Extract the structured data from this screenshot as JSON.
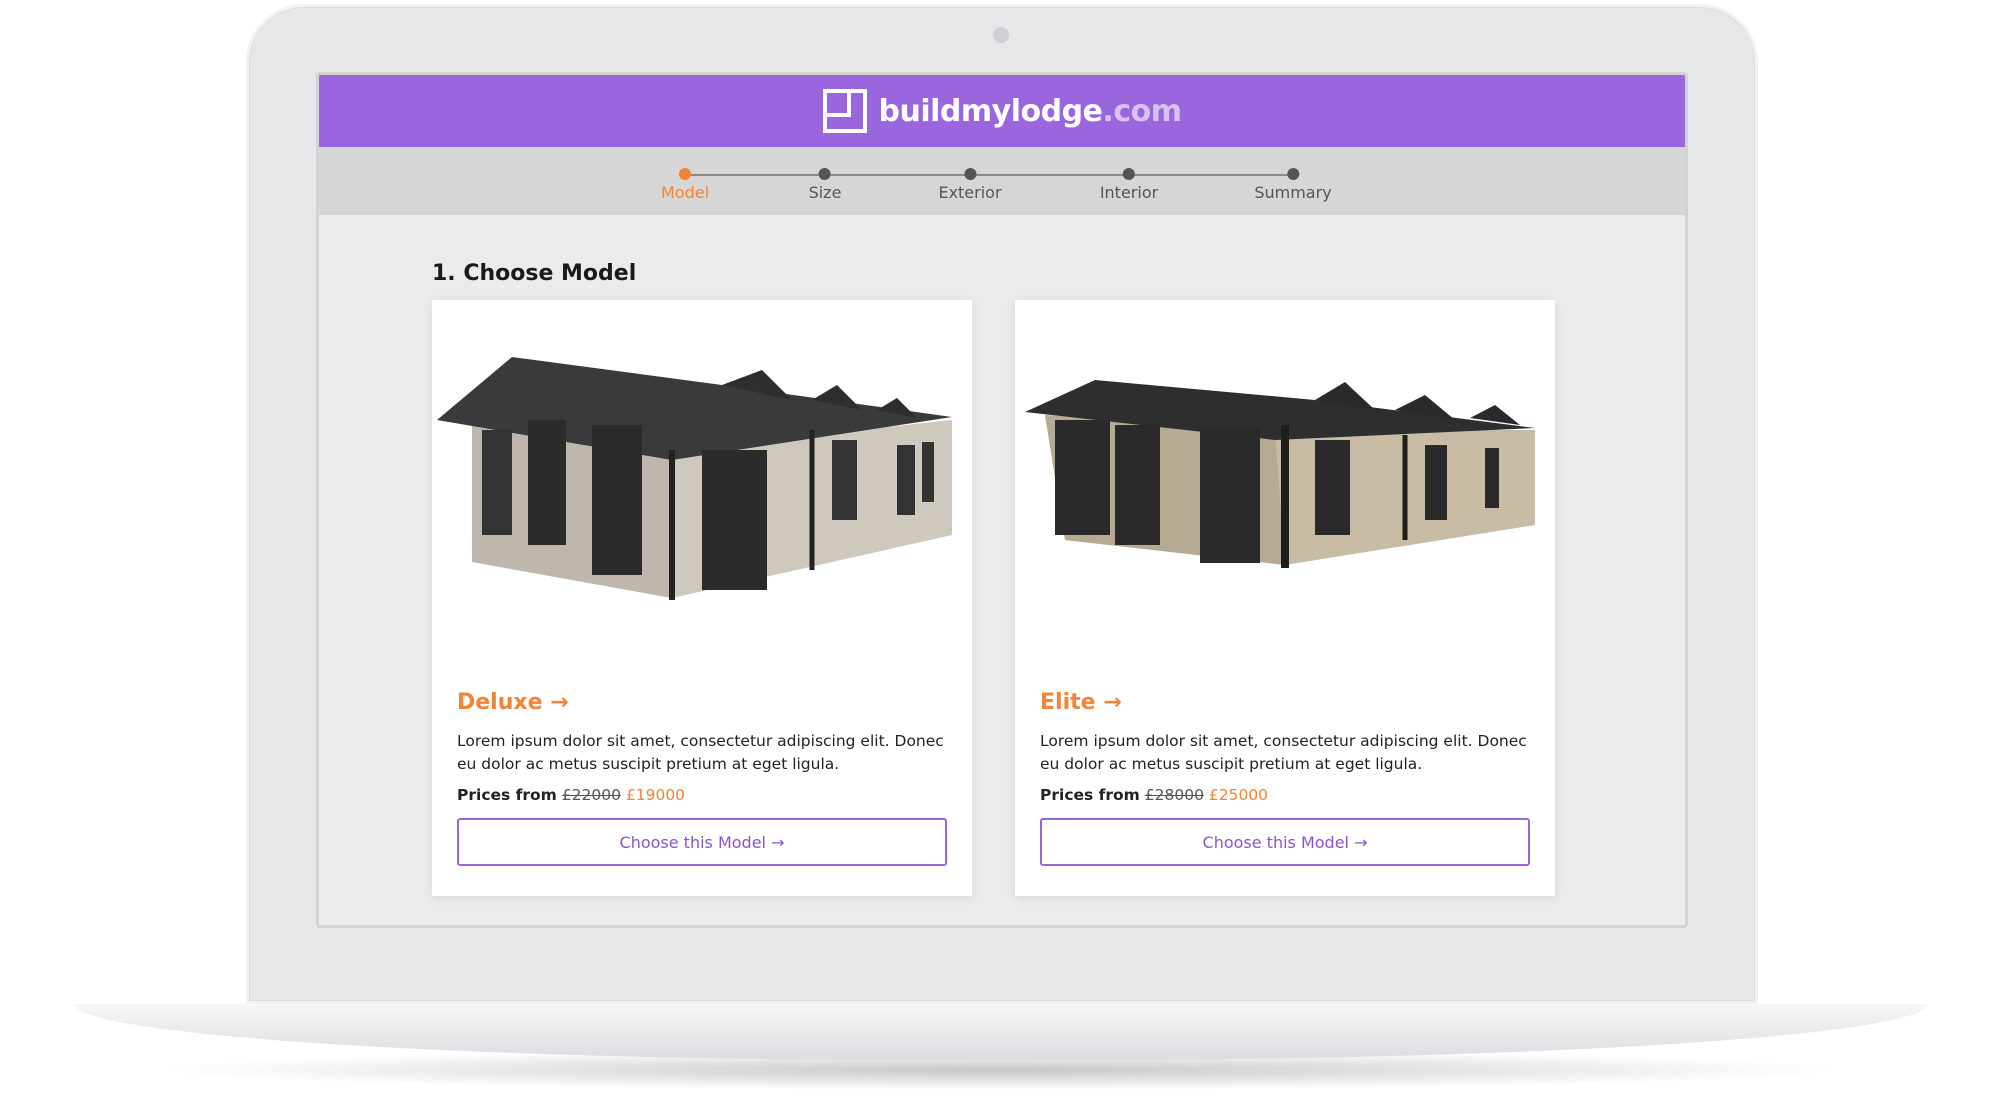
{
  "brand": {
    "name_part1": "build",
    "name_part2": "my",
    "name_part3": "lodge",
    "name_part4": ".com",
    "color": "#9966dd",
    "accent": "#f0843a"
  },
  "steps": [
    {
      "label": "Model",
      "active": true
    },
    {
      "label": "Size",
      "active": false
    },
    {
      "label": "Exterior",
      "active": false
    },
    {
      "label": "Interior",
      "active": false
    },
    {
      "label": "Summary",
      "active": false
    }
  ],
  "section": {
    "title": "1. Choose Model"
  },
  "cards": [
    {
      "image": "lodge-photo-deluxe",
      "name": "Deluxe →",
      "description": "Lorem ipsum dolor sit amet, consectetur adipiscing elit. Donec eu dolor ac metus suscipit pretium at eget ligula.",
      "price_label": "Prices from",
      "old_price": "£22000",
      "new_price": "£19000",
      "button": "Choose this Model →"
    },
    {
      "image": "lodge-photo-elite",
      "name": "Elite →",
      "description": "Lorem ipsum dolor sit amet, consectetur adipiscing elit. Donec eu dolor ac metus suscipit pretium at eget ligula.",
      "price_label": "Prices from",
      "old_price": "£28000",
      "new_price": "£25000",
      "button": "Choose this Model →"
    }
  ]
}
